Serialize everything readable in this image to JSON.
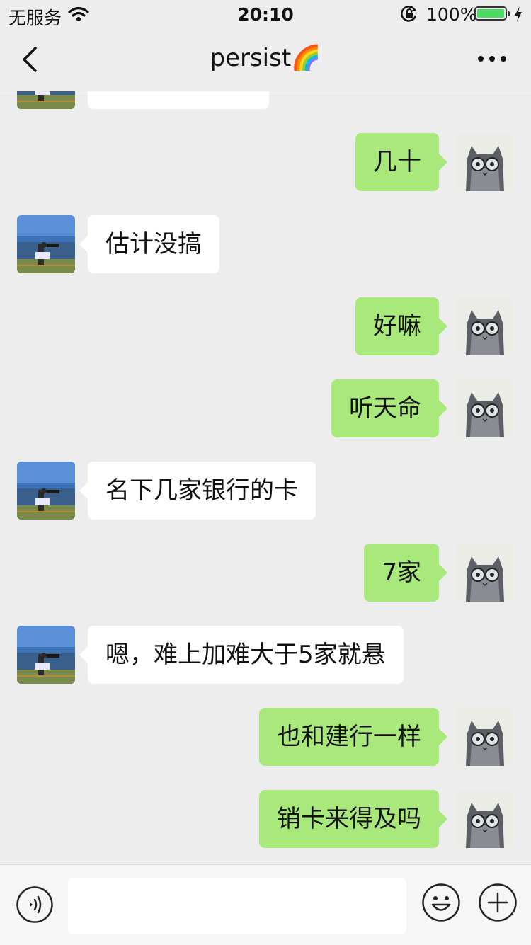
{
  "status_bar": {
    "carrier": "无服务",
    "time": "20:10",
    "battery": "100%",
    "battery_level_percent": 100
  },
  "nav": {
    "title": "persist🌈",
    "icons": [
      "chevron-left-icon",
      "more-icon"
    ]
  },
  "messages": [
    {
      "side": "left",
      "text": ""
    },
    {
      "side": "right",
      "text": "几十"
    },
    {
      "side": "left",
      "text": "估计没搞"
    },
    {
      "side": "right",
      "text": "好嘛"
    },
    {
      "side": "right",
      "text": "听天命"
    },
    {
      "side": "left",
      "text": "名下几家银行的卡"
    },
    {
      "side": "right",
      "text": "7家"
    },
    {
      "side": "left",
      "text": "嗯，难上加难大于5家就悬"
    },
    {
      "side": "right",
      "text": "也和建行一样"
    },
    {
      "side": "right",
      "text": "销卡来得及吗"
    }
  ],
  "input_bar": {
    "value": "",
    "placeholder": "",
    "icons": [
      "voice-icon",
      "emoji-icon",
      "plus-icon"
    ]
  },
  "colors": {
    "background": "#ededed",
    "sent_bubble": "#a9e87a",
    "received_bubble": "#ffffff",
    "battery_fill": "#4cd964"
  }
}
